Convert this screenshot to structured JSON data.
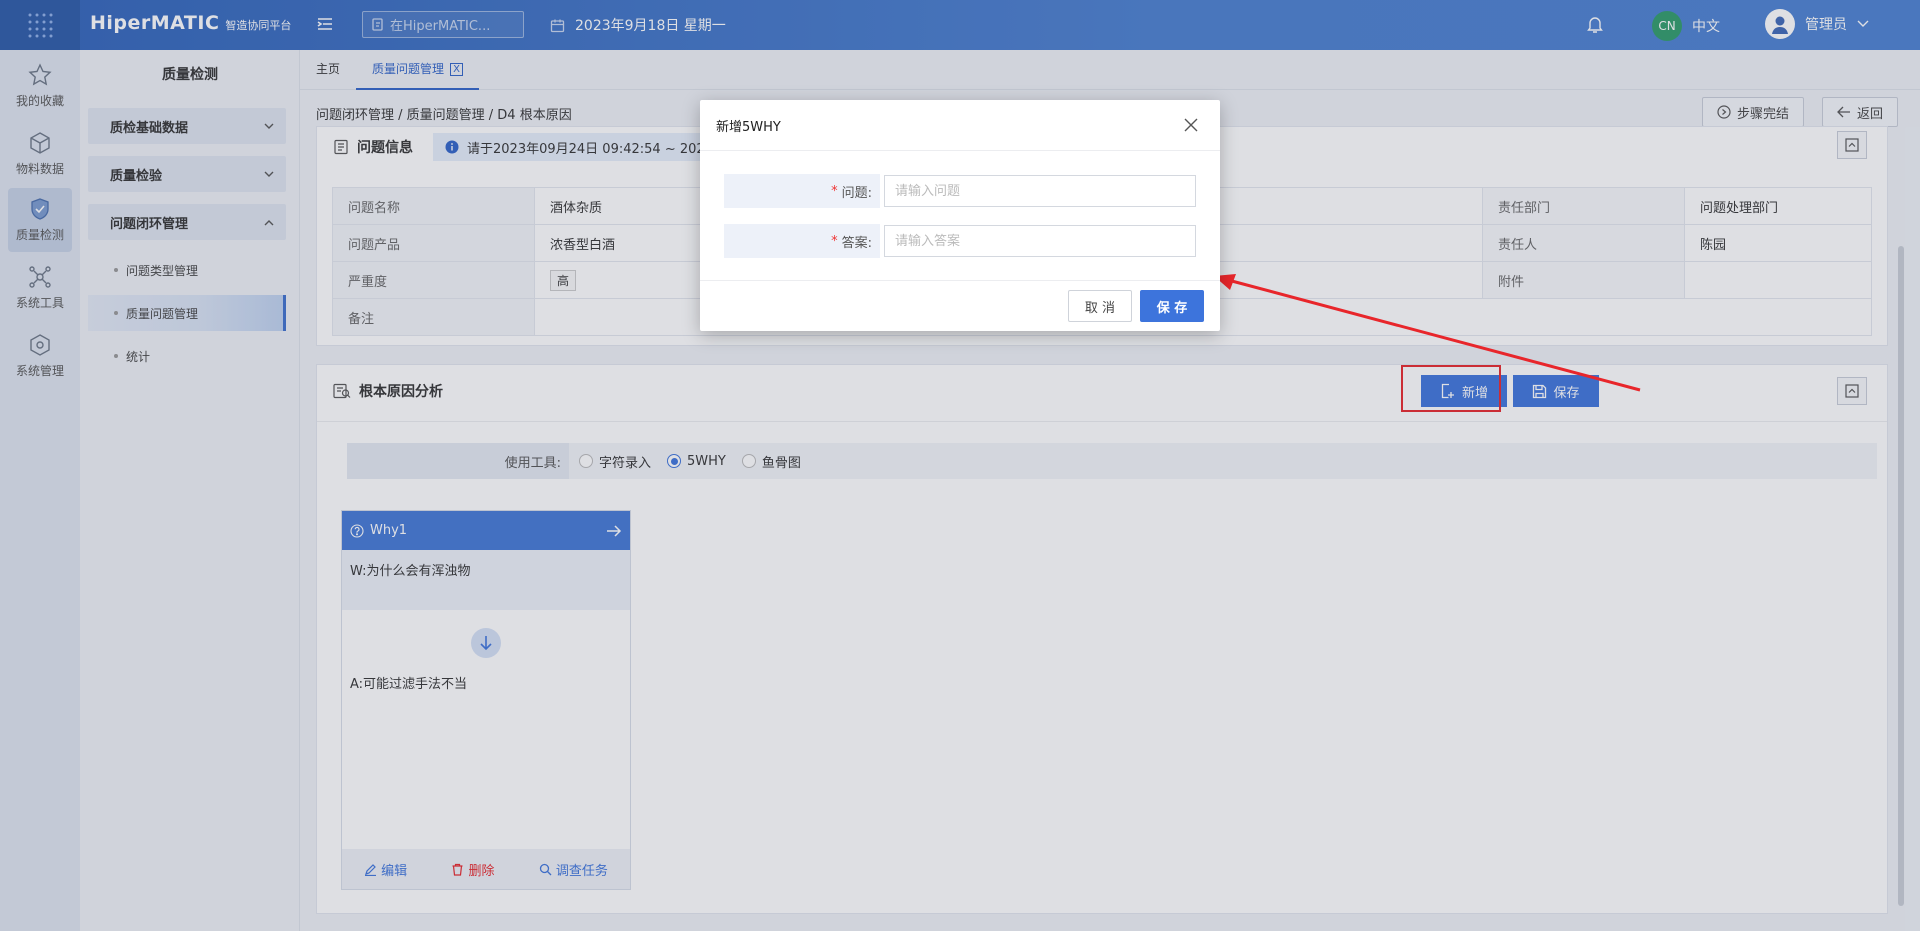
{
  "header": {
    "brand_main": "HiperMATIC",
    "brand_sub": "智造协同平台",
    "search_placeholder": "在HiperMATIC...",
    "date": "2023年9月18日 星期一",
    "lang_badge": "CN",
    "lang_label": "中文",
    "user_name": "管理员"
  },
  "rail": [
    {
      "label": "我的收藏",
      "icon": "star-icon"
    },
    {
      "label": "物料数据",
      "icon": "cube-icon"
    },
    {
      "label": "质量检测",
      "icon": "shield-icon"
    },
    {
      "label": "系统工具",
      "icon": "network-icon"
    },
    {
      "label": "系统管理",
      "icon": "box-icon"
    }
  ],
  "sidebar": {
    "title": "质量检测",
    "groups": [
      {
        "label": "质检基础数据"
      },
      {
        "label": "质量检验"
      },
      {
        "label": "问题闭环管理"
      }
    ],
    "items": [
      {
        "label": "问题类型管理"
      },
      {
        "label": "质量问题管理"
      },
      {
        "label": "统计"
      }
    ]
  },
  "tabs": [
    {
      "label": "主页"
    },
    {
      "label": "质量问题管理",
      "close": "X"
    }
  ],
  "breadcrumb": "问题闭环管理 / 质量问题管理 / D4 根本原因",
  "top_buttons": {
    "complete": "步骤完结",
    "back": "返回"
  },
  "problem_info": {
    "title": "问题信息",
    "notice": "请于2023年09月24日 09:42:54 ~ 2023",
    "rows": [
      {
        "label": "问题名称",
        "value": "酒体杂质",
        "label2": "责任部门",
        "value2": "问题处理部门"
      },
      {
        "label": "问题产品",
        "value": "浓香型白酒",
        "label2": "责任人",
        "value2": "陈园"
      },
      {
        "label": "严重度",
        "value": "高",
        "label2": "附件",
        "value2": ""
      },
      {
        "label": "备注",
        "value": "",
        "label2": "",
        "value2": ""
      }
    ]
  },
  "root_cause": {
    "title": "根本原因分析",
    "add_label": "新增",
    "save_label": "保存",
    "tool_label": "使用工具:",
    "tools": [
      "字符录入",
      "5WHY",
      "鱼骨图"
    ],
    "selected_tool": "5WHY",
    "card": {
      "title": "Why1",
      "question": "W:为什么会有浑浊物",
      "answer": "A:可能过滤手法不当",
      "edit": "编辑",
      "delete": "删除",
      "investigate": "调查任务"
    }
  },
  "modal": {
    "title": "新增5WHY",
    "question_label": "问题:",
    "question_placeholder": "请输入问题",
    "answer_label": "答案:",
    "answer_placeholder": "请输入答案",
    "cancel": "取 消",
    "save": "保 存"
  },
  "colors": {
    "primary": "#3d74dc",
    "header": "#2f63b9",
    "annotation": "#e8262b"
  }
}
